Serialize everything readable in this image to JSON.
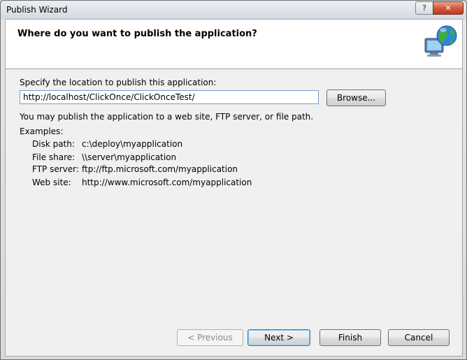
{
  "window": {
    "title": "Publish Wizard",
    "help_label": "?",
    "close_label": "✕"
  },
  "header": {
    "title": "Where do you want to publish the application?",
    "icon": "globe-network-icon"
  },
  "location": {
    "label": "Specify the location to publish this application:",
    "value": "http://localhost/ClickOnce/ClickOnceTest/",
    "browse_label": "Browse..."
  },
  "info": "You may publish the application to a web site, FTP server, or file path.",
  "examples": {
    "heading": "Examples:",
    "items": [
      {
        "label": "Disk path:",
        "value": "c:\\deploy\\myapplication"
      },
      {
        "label": "File share:",
        "value": "\\\\server\\myapplication"
      },
      {
        "label": "FTP server:",
        "value": "ftp://ftp.microsoft.com/myapplication"
      },
      {
        "label": "Web site:",
        "value": "http://www.microsoft.com/myapplication"
      }
    ]
  },
  "buttons": {
    "previous": "< Previous",
    "next": "Next >",
    "finish": "Finish",
    "cancel": "Cancel"
  }
}
